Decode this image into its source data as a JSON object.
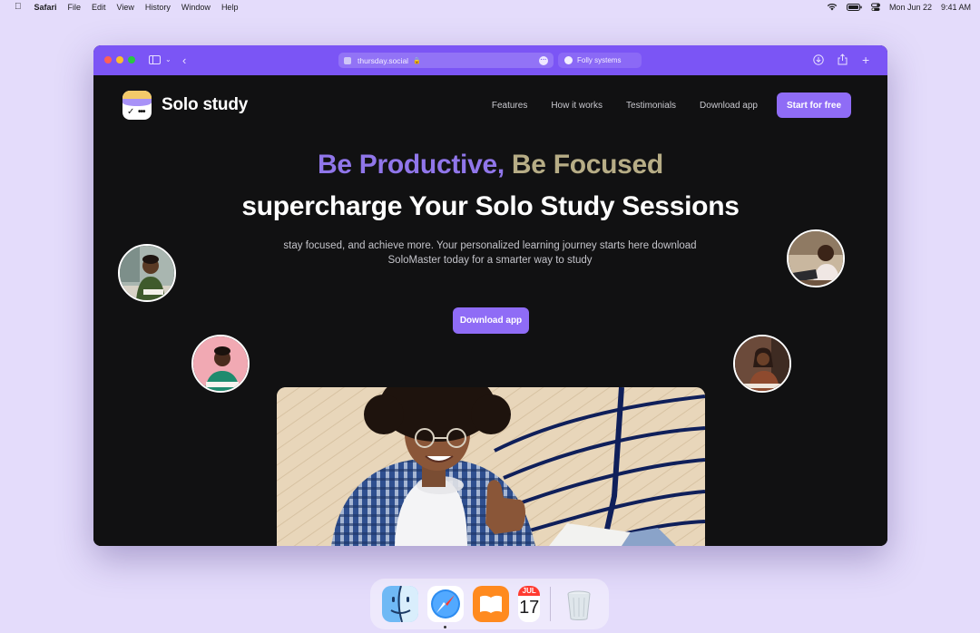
{
  "menubar": {
    "app_name": "Safari",
    "menus": [
      "File",
      "Edit",
      "View",
      "History",
      "Window",
      "Help"
    ],
    "date": "Mon Jun 22",
    "time": "9:41 AM"
  },
  "browser": {
    "url": "thursday.social",
    "second_tab": "Folly systems"
  },
  "site": {
    "brand": "Solo study",
    "nav": [
      "Features",
      "How it works",
      "Testimonials",
      "Download app"
    ],
    "cta": "Start for free",
    "headline_a": "Be Productive,",
    "headline_b": "Be Focused",
    "subheadline": "supercharge Your Solo Study Sessions",
    "description": "stay focused, and achieve more. Your personalized learning journey starts here download SoloMaster today for a smarter way to study",
    "download_button": "Download app"
  },
  "dock": {
    "items": [
      "finder-icon",
      "safari-icon",
      "books-icon",
      "calendar-icon",
      "trash-icon"
    ],
    "calendar_month": "JUL",
    "calendar_day": "17"
  },
  "colors": {
    "accent": "#8f6cf6",
    "toolbar": "#7b55f5",
    "page_bg": "#111112",
    "headline_purple": "#9076ea",
    "headline_gold": "#b7ad86"
  }
}
